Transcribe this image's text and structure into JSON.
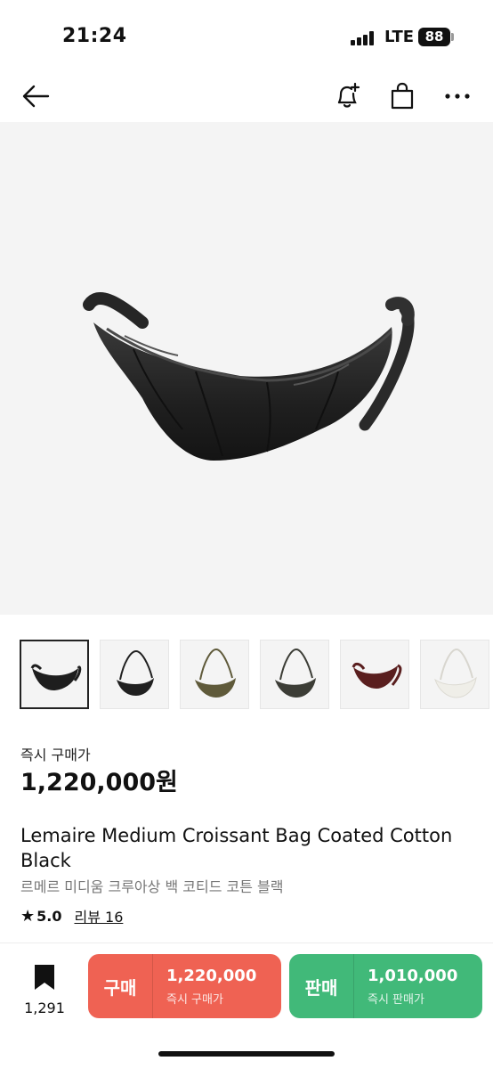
{
  "status": {
    "time": "21:24",
    "network": "LTE",
    "battery": "88"
  },
  "nav": {
    "back": "arrow-left-icon",
    "alert": "bell-plus-icon",
    "bag": "shopping-bag-icon",
    "more": "more-horizontal-icon"
  },
  "product": {
    "price_label": "즉시 구매가",
    "price": "1,220,000원",
    "title": "Lemaire Medium Croissant Bag Coated Cotton Black",
    "subtitle": "르메르 미디움 크루아상 백 코티드 코튼 블랙",
    "rating": "5.0",
    "reviews": "리뷰 16"
  },
  "thumbnails": [
    {
      "color": "#1e1e1e",
      "selected": true
    },
    {
      "color": "#202020"
    },
    {
      "color": "#5f5a3a"
    },
    {
      "color": "#3c3d36"
    },
    {
      "color": "#5a1f1f"
    },
    {
      "color": "#efeee8"
    }
  ],
  "bottom": {
    "bookmark_count": "1,291",
    "buy": {
      "label": "구매",
      "amount": "1,220,000",
      "desc": "즉시 구매가"
    },
    "sell": {
      "label": "판매",
      "amount": "1,010,000",
      "desc": "즉시 판매가"
    }
  },
  "colors": {
    "buy": "#ef6253",
    "sell": "#41b979"
  }
}
